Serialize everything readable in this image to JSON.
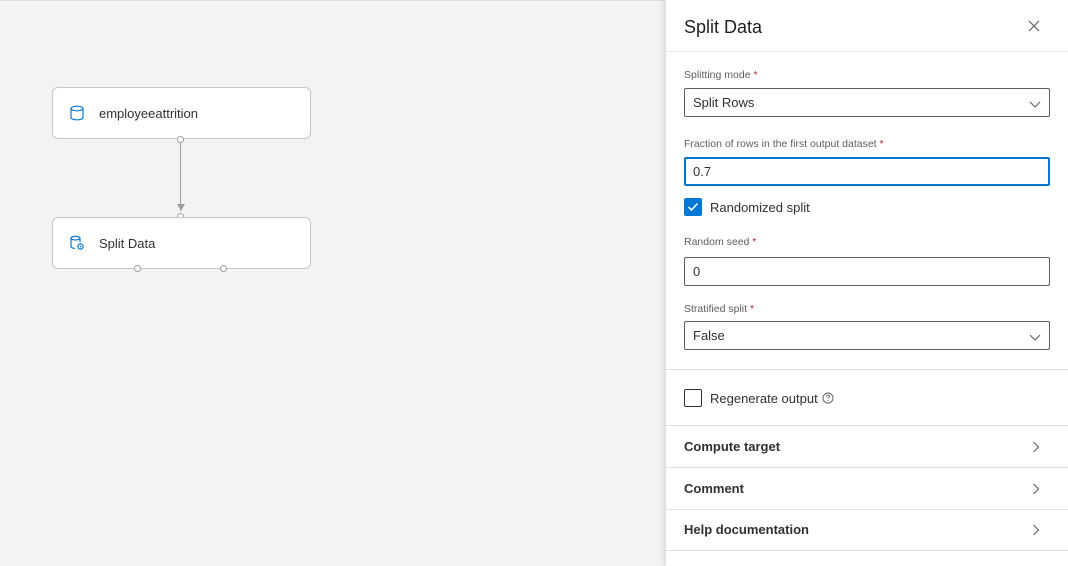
{
  "canvas": {
    "nodes": [
      {
        "label": "employeeattrition",
        "icon": "database-icon"
      },
      {
        "label": "Split Data",
        "icon": "split-data-module-icon"
      }
    ]
  },
  "panel": {
    "title": "Split Data",
    "close_icon": "close-icon",
    "splitting_mode": {
      "label": "Splitting mode",
      "required": "*",
      "value": "Split Rows"
    },
    "fraction": {
      "label": "Fraction of rows in the first output dataset",
      "required": "*",
      "value": "0.7"
    },
    "randomized_split": {
      "label": "Randomized split",
      "checked": true
    },
    "random_seed": {
      "label": "Random seed",
      "required": "*",
      "value": "0"
    },
    "stratified_split": {
      "label": "Stratified split",
      "required": "*",
      "value": "False"
    },
    "regenerate_output": {
      "label": "Regenerate output",
      "checked": false,
      "help_icon": "help-circle-icon"
    },
    "sections": [
      {
        "label": "Compute target",
        "icon": "chevron-right-icon"
      },
      {
        "label": "Comment",
        "icon": "chevron-right-icon"
      },
      {
        "label": "Help documentation",
        "icon": "chevron-right-icon"
      }
    ]
  },
  "colors": {
    "accent": "#0078d4",
    "required": "#a4262c",
    "canvas_bg": "#f3f3f3"
  }
}
